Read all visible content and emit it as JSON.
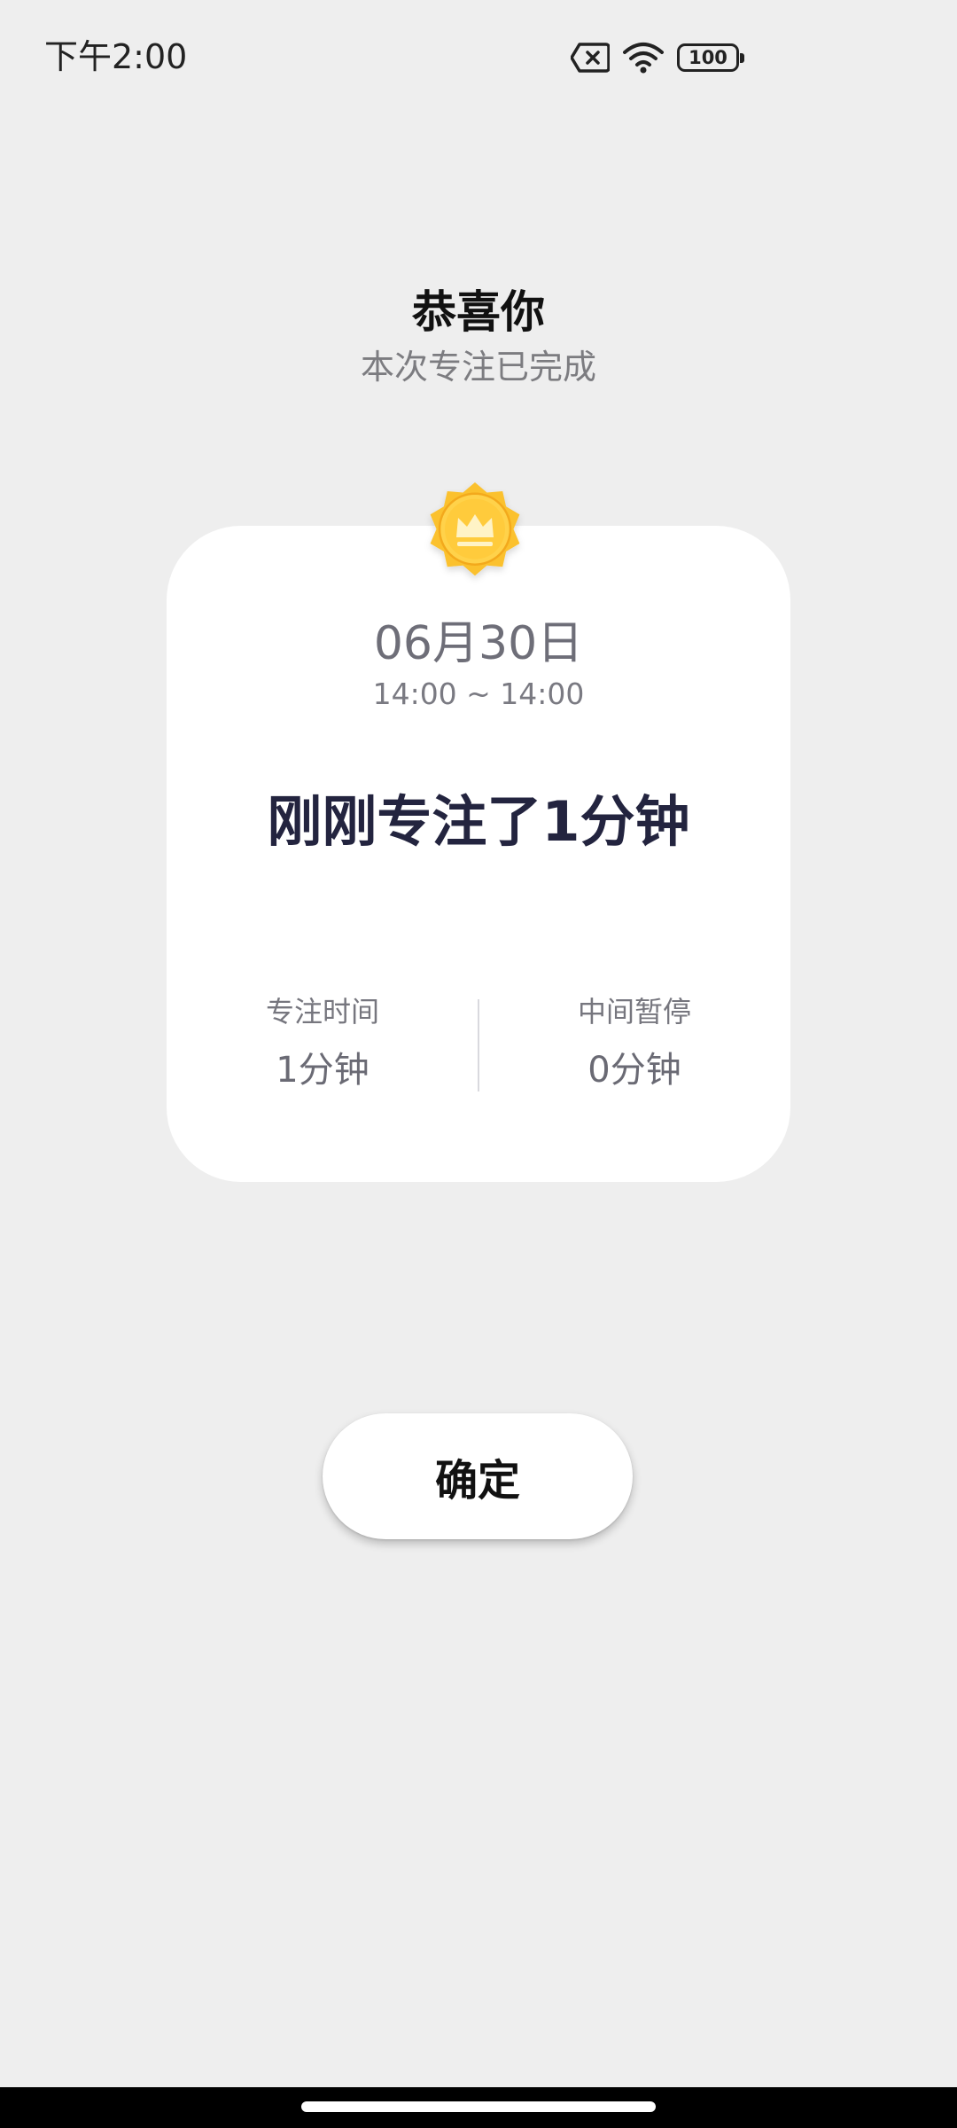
{
  "status_bar": {
    "time": "下午2:00",
    "battery_level": "100",
    "icons": [
      "sim-missing-icon",
      "wifi-icon",
      "battery-icon"
    ]
  },
  "heading": {
    "title": "恭喜你",
    "subtitle": "本次专注已完成"
  },
  "badge": {
    "icon": "crown-icon",
    "color": "#fbc12f"
  },
  "card": {
    "date": "06月30日",
    "time_range": "14:00 ~ 14:00",
    "headline": "刚刚专注了1分钟",
    "stats": [
      {
        "label": "专注时间",
        "value": "1分钟"
      },
      {
        "label": "中间暂停",
        "value": "0分钟"
      }
    ]
  },
  "actions": {
    "confirm_label": "确定"
  },
  "colors": {
    "background": "#eeeeee",
    "card": "#ffffff",
    "headline": "#23243f",
    "badge": "#fbc12f"
  }
}
